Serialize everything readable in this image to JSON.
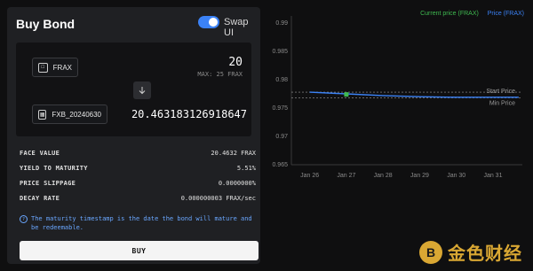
{
  "panel": {
    "title": "Buy Bond",
    "swap_toggle_label": "Swap UI",
    "swap_toggle_on": true
  },
  "swap": {
    "from_token": "FRAX",
    "from_amount": "20",
    "max_label": "MAX: 25 FRAX",
    "to_token": "FXB_20240630",
    "to_amount": "20.463183126918647"
  },
  "stats": [
    {
      "label": "FACE VALUE",
      "value": "20.4632 FRAX"
    },
    {
      "label": "YIELD TO MATURITY",
      "value": "5.51%"
    },
    {
      "label": "PRICE SLIPPAGE",
      "value": "0.0000000%"
    },
    {
      "label": "DECAY RATE",
      "value": "0.000000003 FRAX/sec"
    }
  ],
  "info_text": "The maturity timestamp is the date the bond will mature and be redeemable.",
  "buy_label": "BUY",
  "colors": {
    "accent_blue": "#3b82f6",
    "current_green": "#3fb950"
  },
  "chart_data": {
    "type": "line",
    "legend": [
      "Current price (FRAX)",
      "Price (FRAX)"
    ],
    "x_ticks": [
      "Jan 26",
      "Jan 27",
      "Jan 28",
      "Jan 29",
      "Jan 30",
      "Jan 31"
    ],
    "y_ticks": [
      "0.99",
      "0.985",
      "0.98",
      "0.975",
      "0.97",
      "0.965"
    ],
    "ylim": [
      0.965,
      0.99
    ],
    "series": [
      {
        "name": "Price (FRAX)",
        "x": [
          0,
          1,
          2,
          3,
          4,
          5,
          5.7
        ],
        "values": [
          0.9778,
          0.9775,
          0.9772,
          0.977,
          0.9769,
          0.9769,
          0.9769
        ]
      }
    ],
    "current_price_point": {
      "x": 1,
      "value": 0.9774
    },
    "reference_lines": [
      {
        "label": "Start Price",
        "value": 0.9778
      },
      {
        "label": "Min Price",
        "value": 0.9768
      }
    ]
  }
}
